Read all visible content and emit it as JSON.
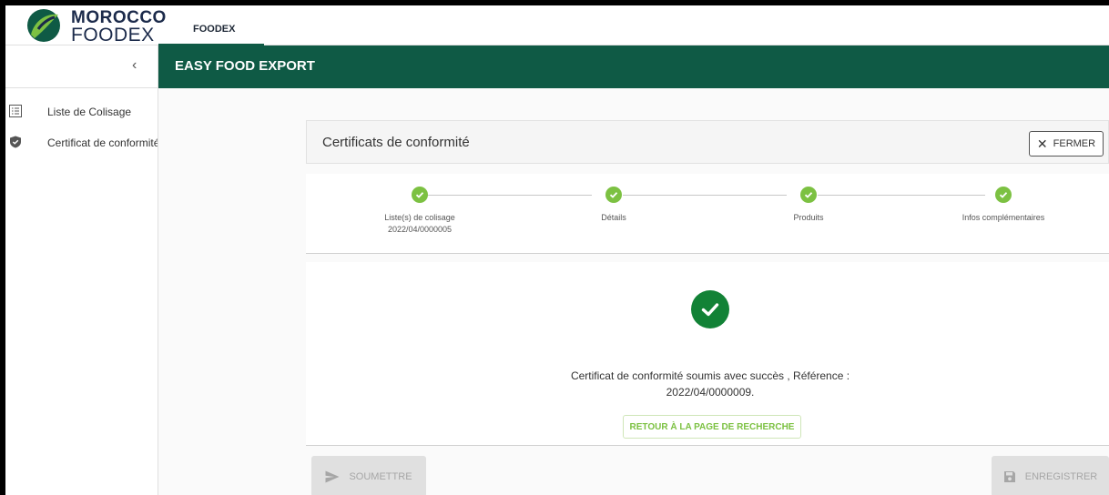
{
  "brand": {
    "line1": "MOROCCO",
    "line2": "FOODEX",
    "colors": {
      "primary": "#0f5a45",
      "accent": "#7cc142",
      "success": "#128236"
    }
  },
  "top_tabs": [
    {
      "label": "FOODEX",
      "active": true
    }
  ],
  "sidebar": {
    "collapse_icon": "chevron-left-icon",
    "collapse_label": "‹",
    "items": [
      {
        "label": "Liste de Colisage",
        "icon": "list-icon"
      },
      {
        "label": "Certificat de conformité",
        "icon": "shield-icon"
      }
    ]
  },
  "header": {
    "title": "EASY FOOD EXPORT"
  },
  "panel": {
    "title": "Certificats de conformité",
    "close_label": "FERMER"
  },
  "stepper": {
    "steps": [
      {
        "label": "Liste(s) de colisage",
        "sublabel": "2022/04/0000005",
        "done": true
      },
      {
        "label": "Détails",
        "sublabel": "",
        "done": true
      },
      {
        "label": "Produits",
        "sublabel": "",
        "done": true
      },
      {
        "label": "Infos complémentaires",
        "sublabel": "",
        "done": true
      }
    ]
  },
  "result": {
    "message_line1": "Certificat de conformité soumis avec succès , Référence :",
    "message_line2": "2022/04/0000009.",
    "return_label": "RETOUR À LA PAGE DE RECHERCHE"
  },
  "actions": {
    "submit_label": "SOUMETTRE",
    "save_label": "ENREGISTRER"
  }
}
